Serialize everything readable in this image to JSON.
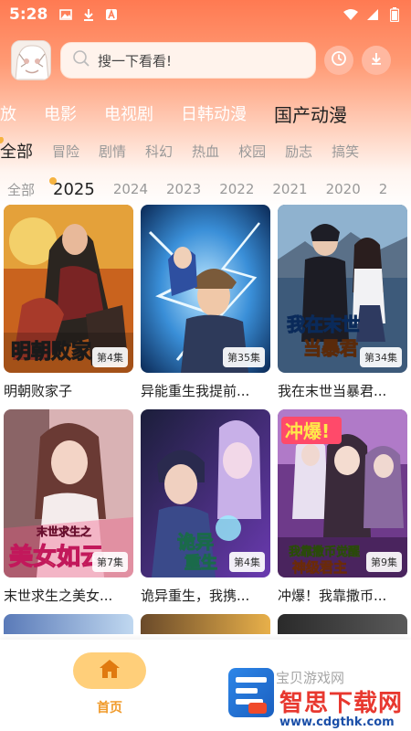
{
  "status_bar": {
    "time": "5:28",
    "icons": [
      "image-icon",
      "download-icon",
      "a-icon",
      "wifi-icon",
      "signal-icon",
      "battery-icon"
    ]
  },
  "header": {
    "search_placeholder": "搜一下看看!",
    "icons": [
      "search-icon",
      "history-icon",
      "download-icon"
    ]
  },
  "main_categories": [
    "放",
    "电影",
    "电视剧",
    "日韩动漫",
    "国产动漫"
  ],
  "main_category_active": "国产动漫",
  "sub_categories": [
    "全部",
    "冒险",
    "剧情",
    "科幻",
    "热血",
    "校园",
    "励志",
    "搞笑"
  ],
  "sub_category_active": "全部",
  "years": [
    "全部",
    "2025",
    "2024",
    "2023",
    "2022",
    "2021",
    "2020",
    "2"
  ],
  "year_active": "2025",
  "items": [
    {
      "title": "明朝败家子",
      "episode": "第4集",
      "cover_text": "明朝败家"
    },
    {
      "title": "异能重生我提前...",
      "episode": "第35集",
      "cover_text": ""
    },
    {
      "title": "我在末世当暴君...",
      "episode": "第34集",
      "cover_text": "我在末世当暴君"
    },
    {
      "title": "末世求生之美女...",
      "episode": "第7集",
      "cover_text": "美女如云"
    },
    {
      "title": "诡异重生，我携...",
      "episode": "第4集",
      "cover_text": "诡异重生"
    },
    {
      "title": "冲爆！我靠撒币...",
      "episode": "第9集",
      "cover_text": "冲爆!"
    }
  ],
  "bottom_nav": {
    "home_label": "首页"
  },
  "watermark": {
    "site_text": "宝贝游戏网",
    "brand": "智思下载网",
    "url": "www.cdgthk.com"
  },
  "colors": {
    "accent_orange": "#ff7a52",
    "home_pill": "#ffcf7a",
    "dot": "#f6b340"
  }
}
